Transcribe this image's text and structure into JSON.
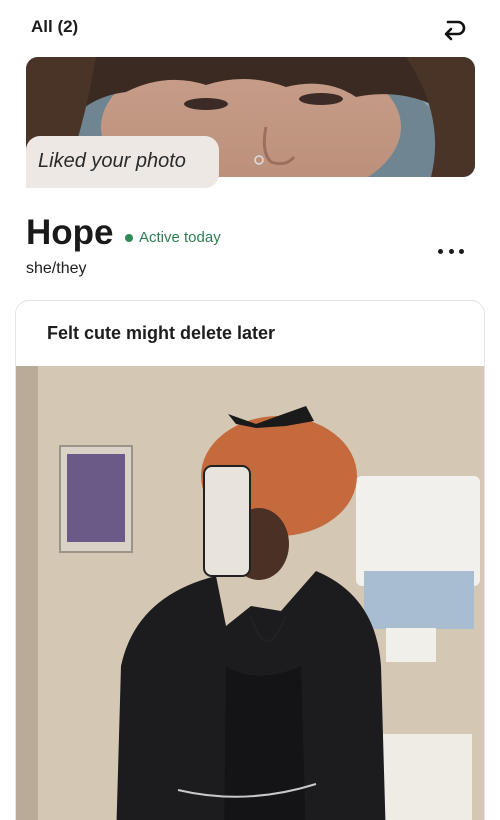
{
  "header": {
    "filter_label": "All (2)",
    "undo_icon": "undo-arrow-icon"
  },
  "like": {
    "message": "Liked your photo"
  },
  "profile": {
    "name": "Hope",
    "status": "Active today",
    "status_color": "#2e8b57",
    "pronouns": "she/they",
    "more_icon": "more-horizontal-icon"
  },
  "post": {
    "caption": "Felt cute might delete later"
  }
}
